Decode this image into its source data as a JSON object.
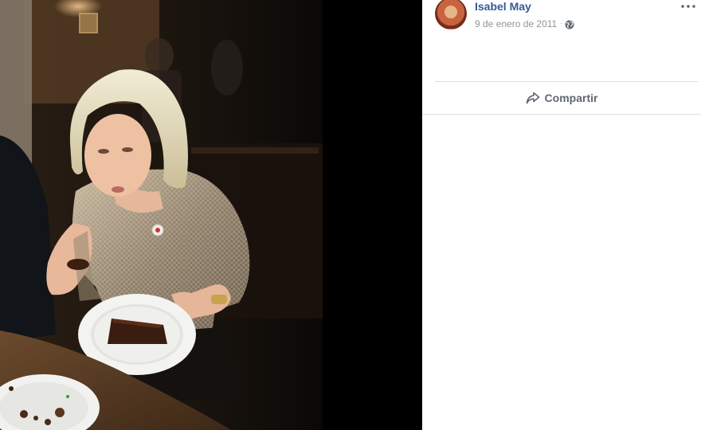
{
  "photo": {
    "icon": "photo-of-woman-eating-chocolate-cake"
  },
  "post": {
    "author_name": "Isabel May",
    "date": "9 de enero de 2011",
    "separator": "·",
    "privacy_icon": "globe-icon",
    "more_icon": "more-dots-icon"
  },
  "actions": {
    "share_label": "Compartir",
    "share_icon": "share-arrow-icon"
  },
  "colors": {
    "author_link": "#365899",
    "meta_text": "#90949c",
    "action_text": "#606770",
    "divider": "#dadde1"
  }
}
